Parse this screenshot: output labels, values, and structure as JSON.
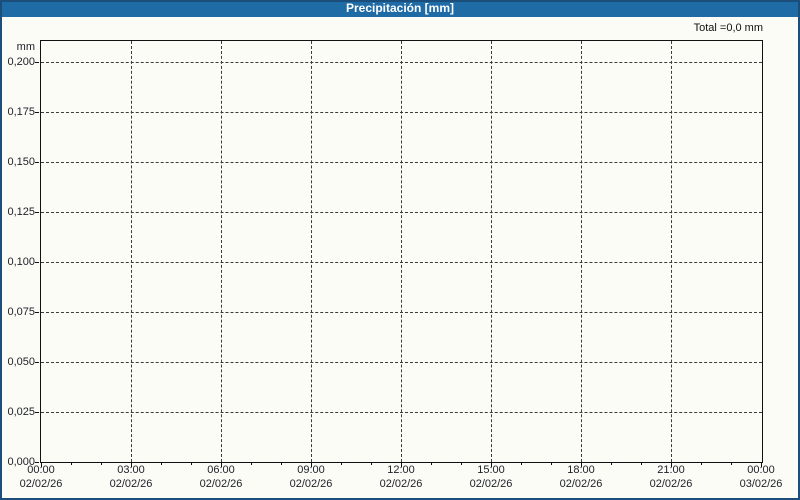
{
  "header": {
    "title": "Precipitación [mm]"
  },
  "summary": {
    "total_label": "Total =0,0 mm"
  },
  "colors": {
    "titlebar_bg": "#1E6BA6",
    "title_text": "#FFFFFF",
    "frame_border": "#1B4E7A",
    "panel_bg": "#FCFCF7",
    "axis": "#111111",
    "grid": "#3C3C3C",
    "tick_text": "#20222A"
  },
  "chart_data": {
    "type": "line",
    "title": "Precipitación [mm]",
    "subtitle": "Total =0,0 mm",
    "ylabel": "mm",
    "xlabel": "",
    "ylim": [
      0,
      0.211
    ],
    "grid": "dashed",
    "legend": "none",
    "total_mm": 0.0,
    "y_ticks": [
      {
        "value": 0.2,
        "label": "0,200"
      },
      {
        "value": 0.175,
        "label": "0,175"
      },
      {
        "value": 0.15,
        "label": "0,150"
      },
      {
        "value": 0.125,
        "label": "0,125"
      },
      {
        "value": 0.1,
        "label": "0,100"
      },
      {
        "value": 0.075,
        "label": "0,075"
      },
      {
        "value": 0.05,
        "label": "0,050"
      },
      {
        "value": 0.025,
        "label": "0,025"
      },
      {
        "value": 0.0,
        "label": "0,000"
      }
    ],
    "x_range_hours": 24,
    "x_minor_step_hours": 1,
    "x_ticks": [
      {
        "hour": 0,
        "time": "00:00",
        "date": "02/02/26"
      },
      {
        "hour": 3,
        "time": "03:00",
        "date": "02/02/26"
      },
      {
        "hour": 6,
        "time": "06:00",
        "date": "02/02/26"
      },
      {
        "hour": 9,
        "time": "09:00",
        "date": "02/02/26"
      },
      {
        "hour": 12,
        "time": "12:00",
        "date": "02/02/26"
      },
      {
        "hour": 15,
        "time": "15:00",
        "date": "02/02/26"
      },
      {
        "hour": 18,
        "time": "18:00",
        "date": "02/02/26"
      },
      {
        "hour": 21,
        "time": "21:00",
        "date": "02/02/26"
      },
      {
        "hour": 24,
        "time": "00:00",
        "date": "03/02/26"
      }
    ],
    "series": [
      {
        "name": "Precipitación",
        "values": []
      }
    ]
  }
}
